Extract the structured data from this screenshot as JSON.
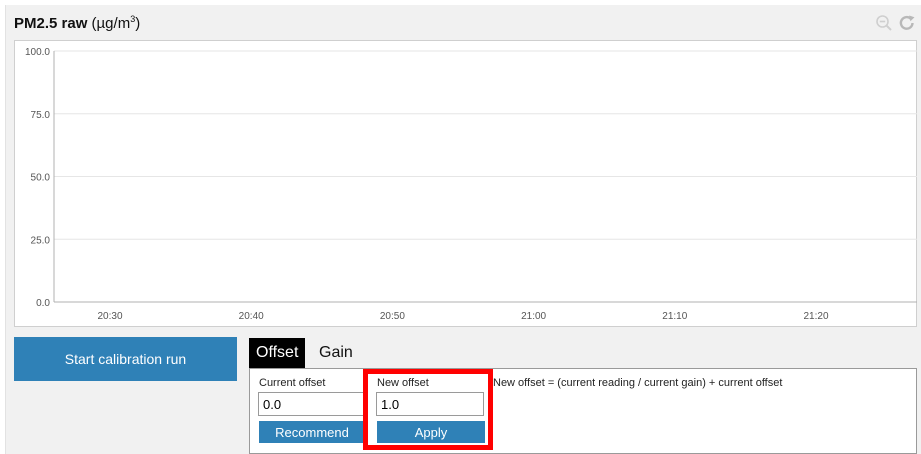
{
  "chart": {
    "title_bold": "PM2.5 raw",
    "title_unit_pre": "(µg/m",
    "title_unit_sup": "3",
    "title_unit_post": ")"
  },
  "toolbar": {
    "zoom_icon": "zoom-out-icon",
    "reset_icon": "refresh-icon"
  },
  "chart_data": {
    "type": "line",
    "title": "PM2.5 raw (µg/m³)",
    "ylim": [
      0,
      100
    ],
    "y_ticks": [
      "0.0",
      "25.0",
      "50.0",
      "75.0",
      "100.0"
    ],
    "y_tick_values": [
      0,
      25,
      50,
      75,
      100
    ],
    "x_ticks": [
      "20:30",
      "20:40",
      "20:50",
      "21:00",
      "21:10",
      "21:20"
    ],
    "series": [],
    "grid": true
  },
  "controls": {
    "start_button": "Start calibration run",
    "tabs": [
      {
        "label": "Offset",
        "active": true
      },
      {
        "label": "Gain",
        "active": false
      }
    ],
    "current_offset_label": "Current offset",
    "current_offset_value": "0.0",
    "new_offset_label": "New offset",
    "new_offset_value": "1.0",
    "recommend_button": "Recommend",
    "apply_button": "Apply",
    "formula": "New offset = (current reading / current gain) + current offset"
  },
  "colors": {
    "button_blue": "#2f81b7",
    "highlight_red": "#ff0000",
    "active_tab": "#000000"
  }
}
